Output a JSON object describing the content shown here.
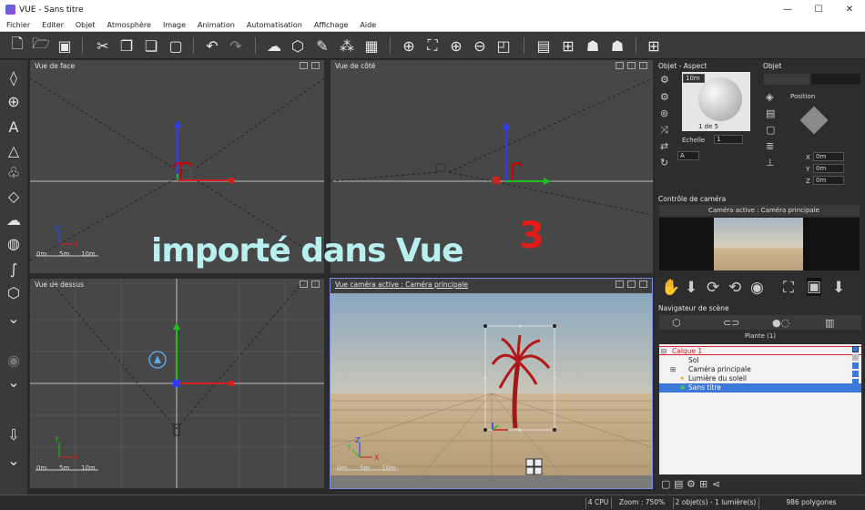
{
  "window": {
    "title": "VUE - Sans titre",
    "minimize": "—",
    "maximize": "☐",
    "close": "✕"
  },
  "menu": [
    "Fichier",
    "Editer",
    "Objet",
    "Atmosphère",
    "Image",
    "Animation",
    "Automatisation",
    "Affichage",
    "Aide"
  ],
  "toolbar_icons": [
    "new-file-icon",
    "open-folder-icon",
    "save-icon",
    "cut-icon",
    "copy-icon",
    "paste-icon",
    "undo-icon",
    "redo-icon",
    "atmosphere-icon",
    "object-icon",
    "material-icon",
    "ecosystem-icon",
    "film-icon",
    "globe-icon",
    "frame-icon",
    "zoom-in-icon",
    "zoom-out-icon",
    "expand-icon",
    "render-icon",
    "add-icon",
    "npr-render-icon",
    "render-settings-icon",
    "layout-icon"
  ],
  "viewports": {
    "front": {
      "title": "Vue de face",
      "scale": [
        "0m",
        "5m",
        "10m"
      ]
    },
    "side": {
      "title": "Vue de côté"
    },
    "top": {
      "title": "Vue de dessus",
      "scale": [
        "0m",
        "5m",
        "10m"
      ]
    },
    "camera": {
      "title": "Vue caméra active : Caméra principale",
      "scale": [
        "0m",
        "5m",
        "10m"
      ]
    }
  },
  "overlay": {
    "text": "importé dans Vue",
    "number": "3"
  },
  "aspect_panel": {
    "title": "Objet - Aspect",
    "preview_size": "10m",
    "page": "1 de 5",
    "scale_label": "Echelle",
    "scale_value": "1",
    "material_letter": "A"
  },
  "object_panel": {
    "title": "Objet",
    "position_label": "Position",
    "x_label": "X",
    "x_value": "0m",
    "y_label": "Y",
    "y_value": "0m",
    "z_label": "Z",
    "z_value": "0m"
  },
  "camera_panel": {
    "title": "Contrôle de caméra",
    "active": "Caméra active : Caméra principale"
  },
  "scene_navigator": {
    "title": "Navigateur de scène",
    "subtitle": "Plante (1)",
    "items": [
      {
        "label": "Calque 1",
        "selected": false
      },
      {
        "label": "Sol",
        "selected": false
      },
      {
        "label": "Caméra principale",
        "selected": false
      },
      {
        "label": "Lumière du soleil",
        "selected": false
      },
      {
        "label": "Sans titre",
        "selected": true
      }
    ]
  },
  "status": {
    "cpu": "4 CPU",
    "zoom": "Zoom : 750%",
    "objects": "2 objet(s) - 1 lumière(s)",
    "polygons": "986 polygones"
  },
  "colors": {
    "accent": "#3c78d8",
    "selection": "#3c78d8",
    "overlay_text": "#b8f0f0",
    "number": "#e21b1b"
  }
}
